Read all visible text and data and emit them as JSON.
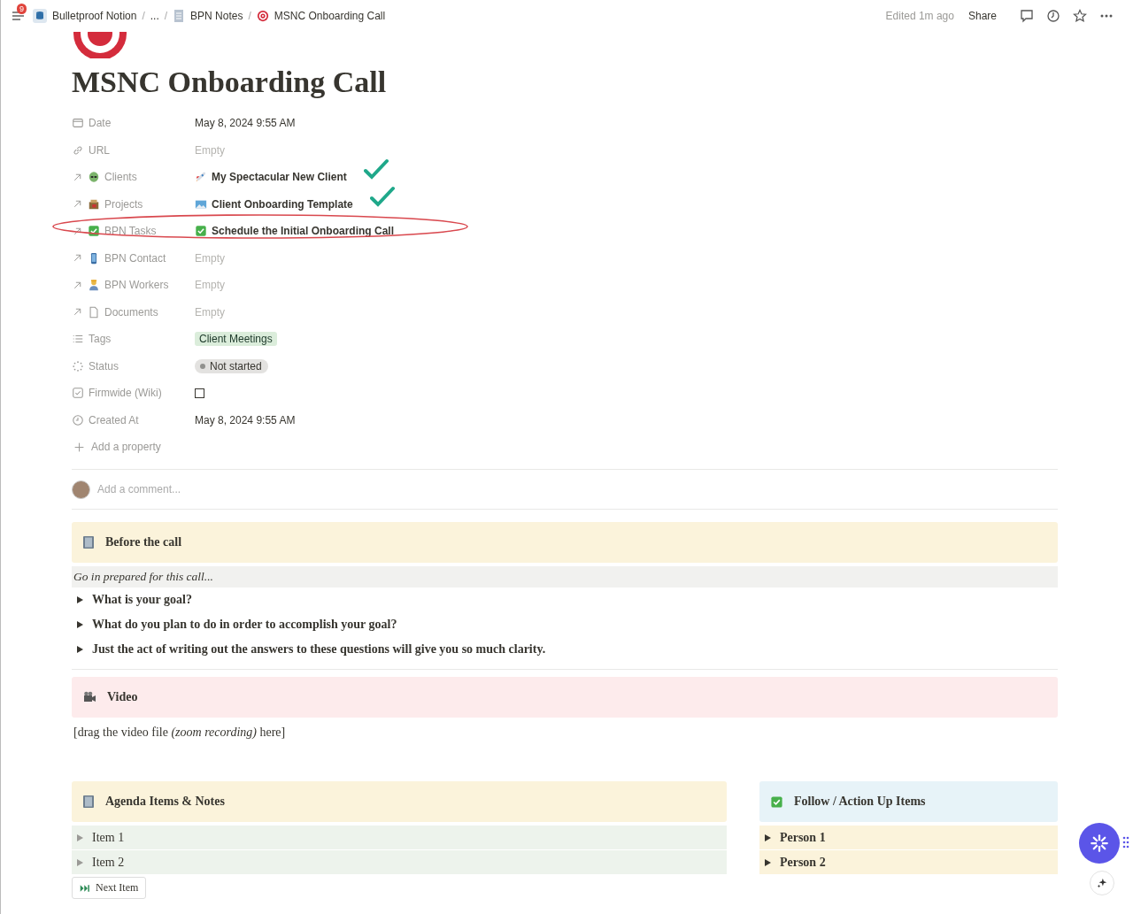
{
  "topbar": {
    "badge": "9",
    "separator": "/",
    "breadcrumbs": [
      {
        "label": "Bulletproof Notion",
        "kind": "database"
      },
      {
        "label": "...",
        "kind": "ellipsis"
      },
      {
        "label": "BPN Notes",
        "kind": "page"
      },
      {
        "label": "MSNC Onboarding Call",
        "kind": "target"
      }
    ],
    "edited": "Edited 1m ago",
    "share": "Share"
  },
  "page": {
    "title": "MSNC Onboarding Call"
  },
  "properties": [
    {
      "label": "Date",
      "kind": "text",
      "value": "May 8, 2024 9:55 AM"
    },
    {
      "label": "URL",
      "kind": "empty",
      "value": "Empty"
    },
    {
      "label": "Clients",
      "kind": "relation",
      "value": "My Spectacular New Client",
      "annotated": true,
      "circled": false
    },
    {
      "label": "Projects",
      "kind": "relation",
      "value": "Client Onboarding Template",
      "annotated": true,
      "circled": false
    },
    {
      "label": "BPN Tasks",
      "kind": "relation",
      "value": "Schedule the Initial Onboarding Call",
      "annotated": false,
      "circled": true
    },
    {
      "label": "BPN Contact",
      "kind": "empty",
      "value": "Empty"
    },
    {
      "label": "BPN Workers",
      "kind": "empty",
      "value": "Empty"
    },
    {
      "label": "Documents",
      "kind": "empty",
      "value": "Empty"
    },
    {
      "label": "Tags",
      "kind": "tag",
      "value": "Client Meetings"
    },
    {
      "label": "Status",
      "kind": "status",
      "value": "Not started"
    },
    {
      "label": "Firmwide (Wiki)",
      "kind": "checkbox",
      "checked": false
    },
    {
      "label": "Created At",
      "kind": "text",
      "value": "May 8, 2024 9:55 AM"
    }
  ],
  "add_property": "Add a property",
  "comment": {
    "placeholder": "Add a comment..."
  },
  "blocks": [
    {
      "kind": "callout",
      "text": "Before the call",
      "color": "#fbf3db"
    },
    {
      "kind": "quote",
      "text": "Go in prepared for this call..."
    },
    {
      "kind": "toggle",
      "text": "What is your goal?"
    },
    {
      "kind": "toggle",
      "text": "What do you plan to do in order to accomplish your goal?"
    },
    {
      "kind": "toggle",
      "text": "Just the act of writing out the answers to these questions will give you so much clarity."
    },
    {
      "kind": "divider"
    },
    {
      "kind": "callout",
      "text": "Video",
      "color": "#fdebec"
    },
    {
      "kind": "paragraph",
      "text": "[drag the video file *(zoom recording)* here]"
    }
  ],
  "columns": [
    {
      "kind": "muted",
      "callout": {
        "text": "Agenda Items & Notes",
        "color": "#fbf3db"
      },
      "toggles": [
        {
          "text": "Item 1",
          "color": "#edf3ec"
        },
        {
          "text": "Item 2",
          "color": "#edf3ec"
        }
      ],
      "button": "Next Item"
    },
    {
      "kind": "strong",
      "callout": {
        "text": "Follow / Action Up Items",
        "color": "#e7f3f8"
      },
      "toggles": [
        {
          "text": "Person 1",
          "color": "#fbf3db"
        },
        {
          "text": "Person 2",
          "color": "#fbf3db"
        }
      ]
    }
  ]
}
